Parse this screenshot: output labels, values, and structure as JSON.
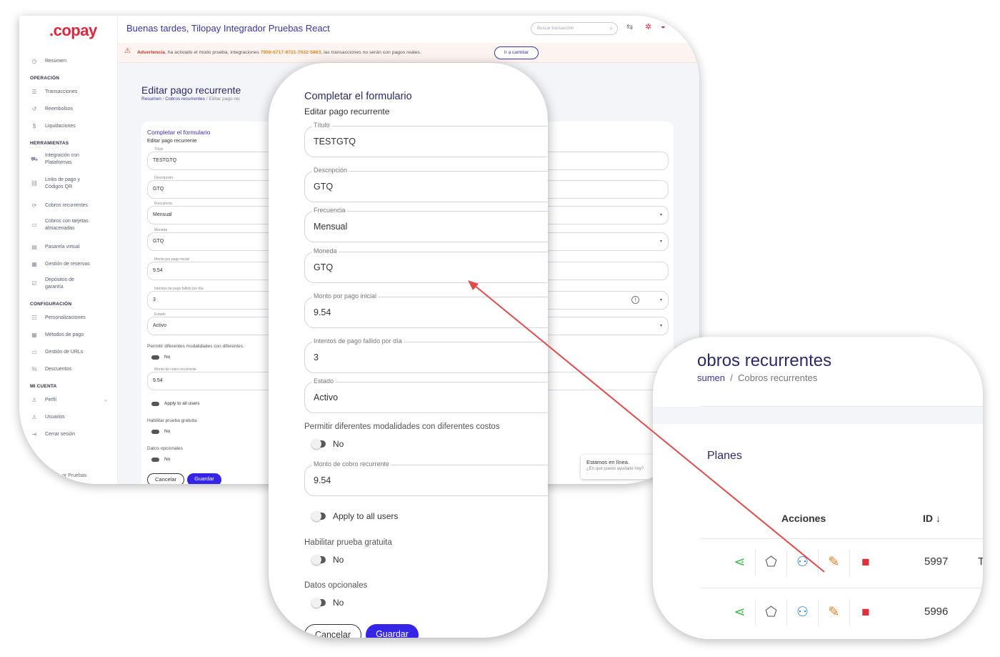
{
  "dashboard": {
    "logo": "copay",
    "greeting": "Buenas tardes, Tilopay Integrador Pruebas React",
    "search_placeholder": "Buscar transacción",
    "warning": {
      "prefix": "Advertencia",
      "text_1": ", ha activado el modo prueba, integraciones ",
      "code": "7959-6717-9721-7032-5863",
      "text_2": ", las transacciones no serán con pagos reales.",
      "button": "Ir a cambiar"
    },
    "sidebar": {
      "summary": "Resumen",
      "sections": [
        {
          "title": "OPERACIÓN",
          "items": [
            "Transacciones",
            "Reembolsos",
            "Liquidaciones"
          ]
        },
        {
          "title": "HERRAMIENTAS",
          "items": [
            "Integración con Plataformas",
            "Links de pago y Códigos QR",
            "Cobros recurrentes",
            "Cobros con tarjetas almacenadas",
            "Pasarela virtual",
            "Gestión de reservas",
            "Depósitos de garantía"
          ]
        },
        {
          "title": "CONFIGURACIÓN",
          "items": [
            "Personalizaciones",
            "Métodos de pago",
            "Gestión de URLs",
            "Descuentos"
          ]
        },
        {
          "title": "MI CUENTA",
          "items": [
            "Perfil",
            "Usuarios",
            "Cerrar sesión"
          ]
        }
      ],
      "footer": "or Pruebas"
    },
    "page_title": "Editar pago recurrente",
    "breadcrumb": {
      "home": "Resumen",
      "section": "Cobros recurrentes",
      "current": "Editar pago rec"
    },
    "card_title": "Completar el formulario",
    "card_subtitle": "Editar pago recurrente",
    "fields": {
      "titulo": {
        "label": "Título",
        "value": "TESTGTQ"
      },
      "descripcion": {
        "label": "Descripción",
        "value": "GTQ"
      },
      "frecuencia": {
        "label": "Frecuencia",
        "value": "Mensual"
      },
      "moneda": {
        "label": "Moneda",
        "value": "GTQ"
      },
      "monto": {
        "label": "Monto por pago inicial",
        "value": "9.54"
      },
      "intentos": {
        "label": "Intentos de pago fallido por día",
        "value": "3"
      },
      "estado": {
        "label": "Estado",
        "value": "Activo"
      },
      "monto_recurrente": {
        "label": "Monto de cobro recurrente",
        "value": "9.54"
      }
    },
    "modalidades_question": "Permitir diferentes modalidades con diferentes",
    "prueba_question": "Habilitar prueba gratuita",
    "datos_question": "Datos opcionales",
    "toggle_no": "No",
    "apply_all": "Apply to all users",
    "cancel": "Cancelar",
    "save": "Guardar",
    "chat": {
      "line1": "Estamos en línea.",
      "line2": "¿En qué puedo ayudarle hoy?"
    }
  },
  "form": {
    "title": "Completar el formulario",
    "subtitle": "Editar pago recurrente",
    "fields": {
      "titulo": {
        "label": "Título",
        "value": "TESTGTQ"
      },
      "descripcion": {
        "label": "Descripción",
        "value": "GTQ"
      },
      "frecuencia": {
        "label": "Frecuencia",
        "value": "Mensual"
      },
      "moneda": {
        "label": "Moneda",
        "value": "GTQ"
      },
      "monto": {
        "label": "Monto por pago inicial",
        "value": "9.54"
      },
      "intentos": {
        "label": "Intentos de pago fallido por día",
        "value": "3"
      },
      "estado": {
        "label": "Estado",
        "value": "Activo"
      },
      "monto_recurrente": {
        "label": "Monto de cobro recurrente",
        "value": "9.54"
      }
    },
    "modalidades_question": "Permitir diferentes modalidades con diferentes costos",
    "modalidades_value": "No",
    "apply_all": "Apply to all users",
    "prueba_question": "Habilitar prueba gratuita",
    "prueba_value": "No",
    "datos_question": "Datos opcionales",
    "datos_value": "No",
    "cancel": "Cancelar",
    "save": "Guardar"
  },
  "plans": {
    "title": "obros recurrentes",
    "breadcrumb": {
      "home": "sumen",
      "current": "Cobros recurrentes"
    },
    "section": "Planes",
    "columns": {
      "actions": "Acciones",
      "id": "ID ↓"
    },
    "rows": [
      {
        "id": "5997",
        "cut": "T"
      },
      {
        "id": "5996",
        "cut": ""
      }
    ]
  },
  "colors": {
    "accent": "#3b35a6",
    "primary_button": "#3525e6",
    "brand_red": "#e0263a",
    "share": "#3dbb48",
    "users": "#2f86d6",
    "edit": "#f07c22",
    "delete": "#e0303a",
    "arrow": "#e24a4a"
  }
}
